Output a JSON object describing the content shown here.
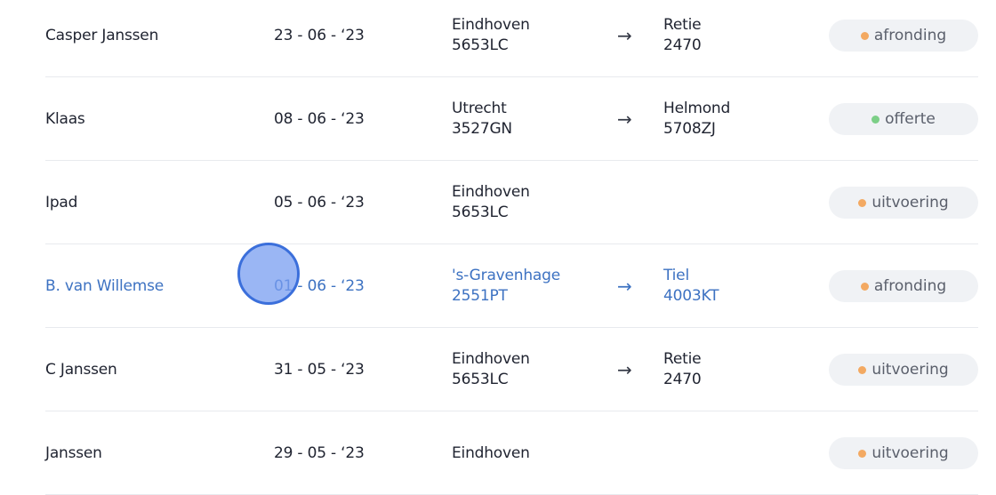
{
  "colors": {
    "highlight_text": "#3d72c2",
    "status_orange": "#f3a962",
    "status_green": "#7ccf87",
    "badge_bg": "#f0f2f5",
    "cursor_fill": "#789ef0"
  },
  "rows": [
    {
      "name": "Casper Janssen",
      "date": "23 - 06 - ‘23",
      "from_city": "Eindhoven",
      "from_postcode": "5653LC",
      "arrow": "→",
      "to_city": "Retie",
      "to_postcode": "2470",
      "status": "afronding",
      "status_color": "orange"
    },
    {
      "name": "Klaas",
      "date": "08 - 06 - ‘23",
      "from_city": "Utrecht",
      "from_postcode": "3527GN",
      "arrow": "→",
      "to_city": "Helmond",
      "to_postcode": "5708ZJ",
      "status": "offerte",
      "status_color": "green"
    },
    {
      "name": "Ipad",
      "date": "05 - 06 - ‘23",
      "from_city": "Eindhoven",
      "from_postcode": "5653LC",
      "arrow": "",
      "to_city": "",
      "to_postcode": "",
      "status": "uitvoering",
      "status_color": "orange"
    },
    {
      "name": "B. van Willemse",
      "date": "01 - 06 - ‘23",
      "from_city": "'s-Gravenhage",
      "from_postcode": "2551PT",
      "arrow": "→",
      "to_city": "Tiel",
      "to_postcode": "4003KT",
      "status": "afronding",
      "status_color": "orange"
    },
    {
      "name": "C Janssen",
      "date": "31 - 05 - ‘23",
      "from_city": "Eindhoven",
      "from_postcode": "5653LC",
      "arrow": "→",
      "to_city": "Retie",
      "to_postcode": "2470",
      "status": "uitvoering",
      "status_color": "orange"
    },
    {
      "name": "Janssen",
      "date": "29 - 05 - ‘23",
      "from_city": "Eindhoven",
      "from_postcode": "",
      "arrow": "",
      "to_city": "",
      "to_postcode": "",
      "status": "uitvoering",
      "status_color": "orange"
    }
  ]
}
